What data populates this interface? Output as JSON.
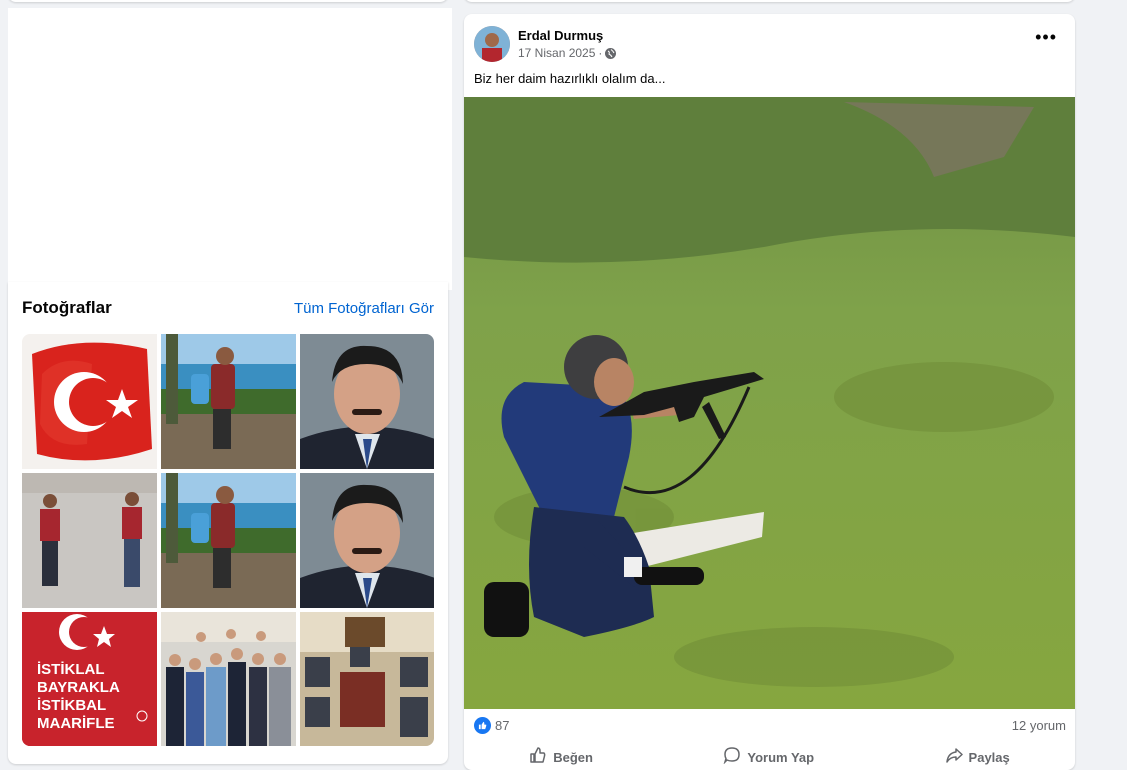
{
  "photos_section": {
    "title": "Fotoğraflar",
    "see_all_link": "Tüm Fotoğrafları Gör",
    "thumbnails": [
      {
        "alt": "turkish-flag"
      },
      {
        "alt": "man-with-backpack-seaside"
      },
      {
        "alt": "portrait-man-suit"
      },
      {
        "alt": "two-men-walking"
      },
      {
        "alt": "man-with-backpack-seaside"
      },
      {
        "alt": "portrait-man-suit"
      },
      {
        "alt": "istiklal-poster",
        "text_lines": [
          "İSTİKLAL",
          "BAYRAKLA",
          "İSTİKBAL",
          "MAARİFLE"
        ]
      },
      {
        "alt": "group-photo"
      },
      {
        "alt": "meeting-room"
      }
    ]
  },
  "post": {
    "author": "Erdal Durmuş",
    "date": "17 Nisan 2025",
    "separator": "·",
    "privacy_icon": "globe-icon",
    "more_icon": "more-options-icon",
    "more_glyph": "•••",
    "text": "Biz her daim hazırlıklı olalım da...",
    "reactions_count": "87",
    "comments": "12 yorum",
    "actions": {
      "like": "Beğen",
      "comment": "Yorum Yap",
      "share": "Paylaş"
    }
  },
  "colors": {
    "link": "#0064d1",
    "like_blue": "#1877f2",
    "muted": "#65676b",
    "background": "#f0f2f5"
  }
}
